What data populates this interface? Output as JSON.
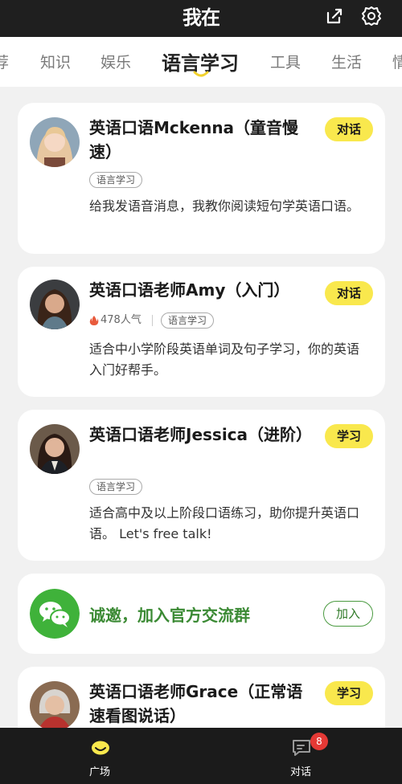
{
  "app": {
    "logo": "我在"
  },
  "tabs": [
    "荐",
    "知识",
    "娱乐",
    "语言学习",
    "工具",
    "生活",
    "情"
  ],
  "active_tab_index": 3,
  "cards": [
    {
      "title": "英语口语Mckenna（童音慢速）",
      "badge": "对话",
      "tag": "语言学习",
      "popularity": "",
      "description": "给我发语音消息，我教你阅读短句学英语口语。"
    },
    {
      "title": "英语口语老师Amy（入门）",
      "badge": "对话",
      "tag": "语言学习",
      "popularity": "478人气",
      "description": "适合中小学阶段英语单词及句子学习，你的英语入门好帮手。"
    },
    {
      "title": "英语口语老师Jessica（进阶）",
      "badge": "学习",
      "tag": "语言学习",
      "popularity": "",
      "description": "适合高中及以上阶段口语练习，助你提升英语口语。 Let's free talk!"
    },
    {
      "title": "英语口语老师Grace（正常语速看图说话）",
      "badge": "学习",
      "tag": "",
      "popularity": "",
      "description": ""
    }
  ],
  "group_card": {
    "text": "诚邀，加入官方交流群",
    "button": "加入"
  },
  "bottom_nav": [
    {
      "label": "广场",
      "icon": "plaza-icon",
      "active": true
    },
    {
      "label": "对话",
      "icon": "chat-icon",
      "active": false,
      "badge": "8"
    }
  ],
  "colors": {
    "accent_yellow": "#f9e84d",
    "wechat_green": "#3fb23a",
    "dark_bar": "#1f1f1f",
    "notification_red": "#e53935"
  }
}
